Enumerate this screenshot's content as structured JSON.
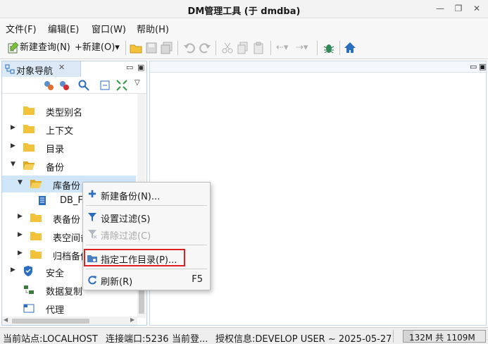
{
  "window": {
    "title": "DM管理工具 (于 dmdba)"
  },
  "menubar": {
    "items": [
      {
        "label": "文件(F)"
      },
      {
        "label": "编辑(E)"
      },
      {
        "label": "窗口(W)"
      },
      {
        "label": "帮助(H)"
      }
    ]
  },
  "toolbar": {
    "new_query_label": "新建查询(N)",
    "new_label": "+新建(O)▾"
  },
  "left_panel": {
    "tab_label": "对象导航",
    "tree": [
      {
        "label": "类型别名"
      },
      {
        "label": "上下文"
      },
      {
        "label": "目录"
      },
      {
        "label": "备份"
      },
      {
        "label": "库备份"
      },
      {
        "label": "DB_F"
      },
      {
        "label": "表备份"
      },
      {
        "label": "表空间备"
      },
      {
        "label": "归档备份"
      },
      {
        "label": "安全"
      },
      {
        "label": "数据复制"
      },
      {
        "label": "代理"
      }
    ]
  },
  "context_menu": {
    "items": [
      {
        "label": "新建备份(N)...",
        "shortcut": "",
        "enabled": true
      },
      {
        "label": "设置过滤(S)",
        "shortcut": "",
        "enabled": true
      },
      {
        "label": "清除过滤(C)",
        "shortcut": "",
        "enabled": false
      },
      {
        "label": "指定工作目录(P)...",
        "shortcut": "",
        "enabled": true
      },
      {
        "label": "刷新(R)",
        "shortcut": "F5",
        "enabled": true
      }
    ]
  },
  "statusbar": {
    "site": "当前站点:LOCALHOST",
    "port": "连接端口:5236",
    "login": "当前登...",
    "license": "授权信息:DEVELOP USER ~ 2025-05-27",
    "memory": "132M 共 1109M",
    "memory_fraction": 0.12
  },
  "colors": {
    "folder": "#f2c23a",
    "accent": "#2a6ebd",
    "highlight": "#e02020",
    "selection": "#cfe5f8"
  }
}
